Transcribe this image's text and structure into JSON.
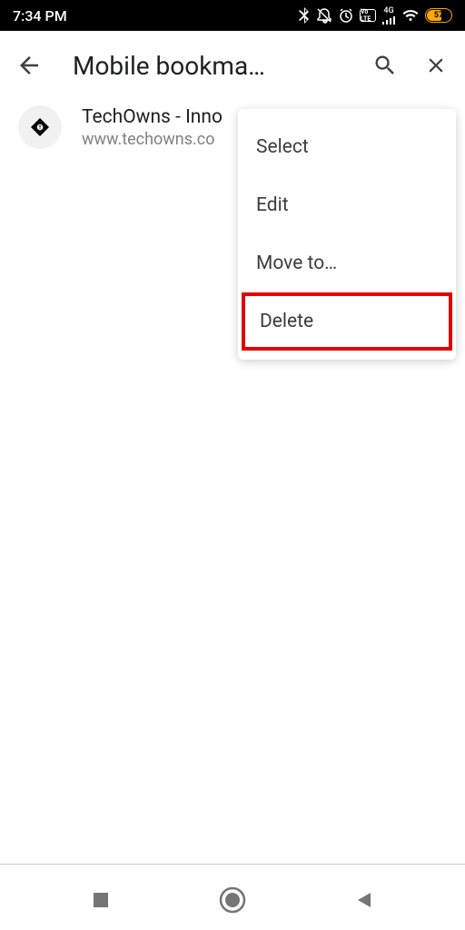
{
  "status": {
    "time": "7:34 PM",
    "network": "4G",
    "volte": "Vo LTE",
    "battery_pct": "57"
  },
  "header": {
    "title": "Mobile bookma…"
  },
  "bookmark": {
    "title": "TechOwns - Inno",
    "url": "www.techowns.co"
  },
  "menu": {
    "items": [
      "Select",
      "Edit",
      "Move to…",
      "Delete"
    ]
  }
}
